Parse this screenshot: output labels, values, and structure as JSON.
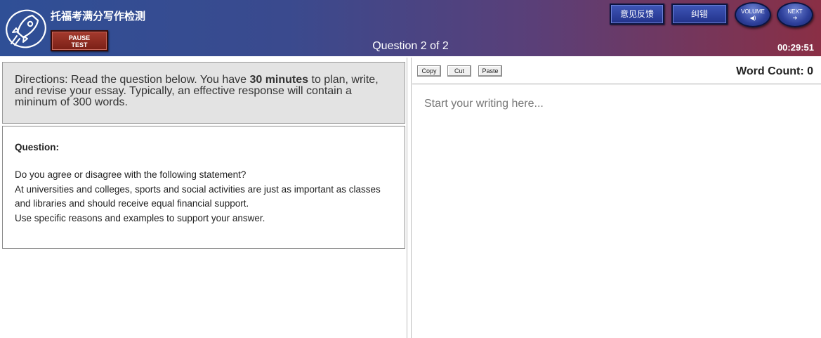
{
  "header": {
    "app_title": "托福考满分写作检测",
    "pause_label_line1": "PAUSE",
    "pause_label_line2": "TEST",
    "question_counter": "Question 2 of 2",
    "timer": "00:29:51",
    "buttons": {
      "feedback": "意见反馈",
      "correct": "纠错",
      "volume": "VOLUME",
      "next": "NEXT"
    }
  },
  "directions": {
    "prefix": "Directions: Read the question below. You have ",
    "emphasis": "30 minutes",
    "suffix": " to plan, write, and revise your essay. Typically, an effective response will contain a mininum of 300 words."
  },
  "question": {
    "label": "Question:",
    "lines": [
      "Do you agree or disagree with the following statement?",
      "At universities and colleges, sports and social activities are just as important as classes and libraries and should receive equal financial support.",
      "Use specific reasons and examples to support your answer."
    ]
  },
  "toolbar": {
    "copy": "Copy",
    "cut": "Cut",
    "paste": "Paste",
    "word_count": "Word Count: 0"
  },
  "editor": {
    "placeholder": "Start your writing here...",
    "value": ""
  },
  "colors": {
    "header_left": "#2f4f96",
    "header_right": "#8a2f45",
    "pause_button": "#8b2a20",
    "blue_button": "#2d3f9a"
  },
  "icons": {
    "logo": "rocket-logo-icon",
    "volume": "speaker-icon",
    "next": "arrow-right-icon"
  }
}
